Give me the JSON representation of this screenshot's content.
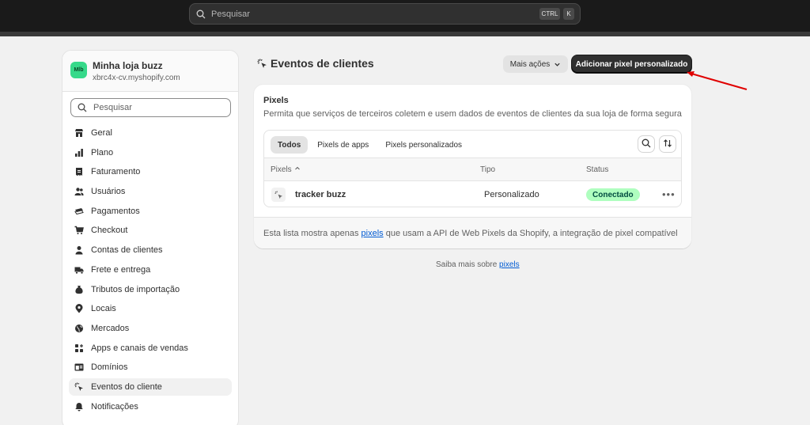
{
  "topbar": {
    "search_placeholder": "Pesquisar",
    "kbd_ctrl": "CTRL",
    "kbd_k": "K"
  },
  "store": {
    "initials": "Mlb",
    "name": "Minha loja buzz",
    "domain": "xbrc4x-cv.myshopify.com",
    "avatar_color": "#36d98a"
  },
  "sidebar": {
    "search_placeholder": "Pesquisar",
    "items": [
      {
        "label": "Geral",
        "icon": "store-icon"
      },
      {
        "label": "Plano",
        "icon": "chart-icon"
      },
      {
        "label": "Faturamento",
        "icon": "receipt-icon"
      },
      {
        "label": "Usuários",
        "icon": "users-icon"
      },
      {
        "label": "Pagamentos",
        "icon": "cash-icon"
      },
      {
        "label": "Checkout",
        "icon": "cart-icon"
      },
      {
        "label": "Contas de clientes",
        "icon": "person-icon"
      },
      {
        "label": "Frete e entrega",
        "icon": "truck-icon"
      },
      {
        "label": "Tributos de importação",
        "icon": "money-bag-icon"
      },
      {
        "label": "Locais",
        "icon": "location-icon"
      },
      {
        "label": "Mercados",
        "icon": "globe-icon"
      },
      {
        "label": "Apps e canais de vendas",
        "icon": "apps-icon"
      },
      {
        "label": "Domínios",
        "icon": "domain-icon"
      },
      {
        "label": "Eventos do cliente",
        "icon": "cursor-click-icon",
        "active": true
      },
      {
        "label": "Notificações",
        "icon": "bell-icon"
      }
    ]
  },
  "header": {
    "title": "Eventos de clientes",
    "more_actions": "Mais ações",
    "primary_action": "Adicionar pixel personalizado"
  },
  "card": {
    "title": "Pixels",
    "description": "Permita que serviços de terceiros coletem e usem dados de eventos de clientes da sua loja de forma segura",
    "tabs": [
      "Todos",
      "Pixels de apps",
      "Pixels personalizados"
    ],
    "active_tab": "Todos",
    "columns": [
      "Pixels",
      "Tipo",
      "Status"
    ],
    "rows": [
      {
        "name": "tracker buzz",
        "type": "Personalizado",
        "status": "Conectado"
      }
    ],
    "footer_pre": "Esta lista mostra apenas",
    "footer_link": "pixels",
    "footer_post": "que usam a API de Web Pixels da Shopify, a integração de pixel compatível"
  },
  "learn_more": {
    "pre": "Saiba mais sobre",
    "link": "pixels"
  },
  "colors": {
    "accent_link": "#005bd3",
    "badge_bg": "#affebf",
    "badge_text": "#014b40",
    "annotation_arrow": "#e00000"
  }
}
